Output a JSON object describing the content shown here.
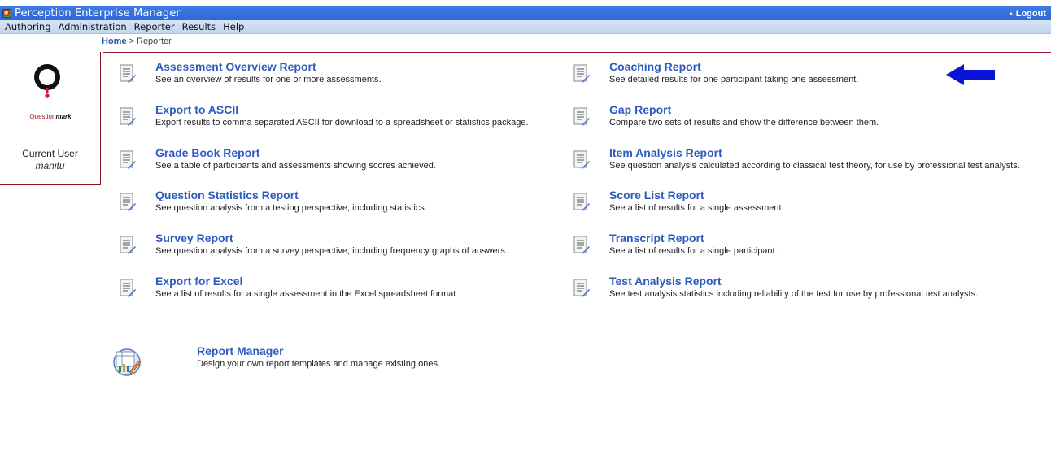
{
  "window": {
    "title": "Perception Enterprise Manager",
    "logout_label": "Logout"
  },
  "menu": [
    "Authoring",
    "Administration",
    "Reporter",
    "Results",
    "Help"
  ],
  "breadcrumb": {
    "home": "Home",
    "separator": ">",
    "current": "Reporter"
  },
  "logo": {
    "text_main": "Question",
    "text_bold": "mark"
  },
  "user": {
    "label": "Current User",
    "name": "manitu"
  },
  "reports": {
    "left": [
      {
        "title": "Assessment Overview Report",
        "desc": "See an overview of results for one or more assessments."
      },
      {
        "title": "Export to ASCII",
        "desc": "Export results to comma separated ASCII for download to a spreadsheet or statistics package."
      },
      {
        "title": "Grade Book Report",
        "desc": "See a table of participants and assessments showing scores achieved."
      },
      {
        "title": "Question Statistics Report",
        "desc": "See question analysis from a testing perspective, including statistics."
      },
      {
        "title": "Survey Report",
        "desc": "See question analysis from a survey perspective, including frequency graphs of answers."
      },
      {
        "title": "Export for Excel",
        "desc": "See a list of results for a single assessment in the Excel spreadsheet format"
      }
    ],
    "right": [
      {
        "title": "Coaching Report",
        "desc": "See detailed results for one participant taking one assessment."
      },
      {
        "title": "Gap Report",
        "desc": "Compare two sets of results and show the difference between them."
      },
      {
        "title": "Item Analysis Report",
        "desc": "See question analysis calculated according to classical test theory, for use by professional test analysts."
      },
      {
        "title": "Score List Report",
        "desc": "See a list of results for a single assessment."
      },
      {
        "title": "Transcript Report",
        "desc": "See a list of results for a single participant."
      },
      {
        "title": "Test Analysis Report",
        "desc": "See test analysis statistics including reliability of the test for use by professional test analysts."
      }
    ]
  },
  "report_manager": {
    "title": "Report Manager",
    "desc": "Design your own report templates and manage existing ones."
  },
  "colors": {
    "title_bar": "#2f69d6",
    "menu_bar": "#c3d5ef",
    "link": "#2e5bbf",
    "brand_red": "#b0152b",
    "arrow": "#0a14d8"
  }
}
